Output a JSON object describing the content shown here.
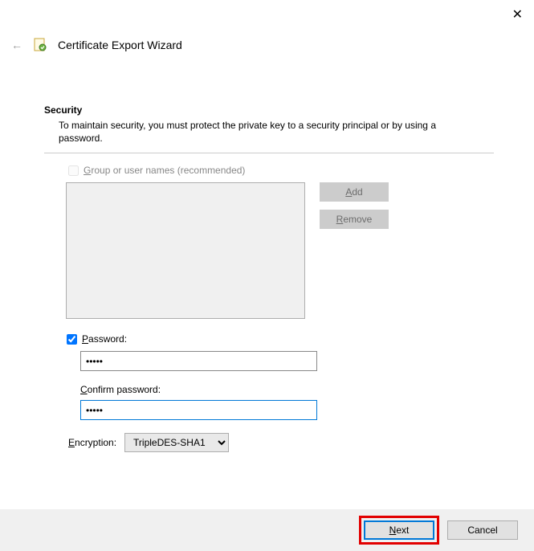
{
  "window": {
    "title": "Certificate Export Wizard"
  },
  "section": {
    "heading": "Security",
    "description": "To maintain security, you must protect the private key to a security principal or by using a password."
  },
  "groups": {
    "checkbox_label_prefix": "G",
    "checkbox_label_rest": "roup or user names (recommended)",
    "checked": false,
    "disabled": true,
    "add_label_prefix": "A",
    "add_label_rest": "dd",
    "remove_label_prefix": "R",
    "remove_label_rest": "emove"
  },
  "password": {
    "checkbox_label_prefix": "P",
    "checkbox_label_rest": "assword:",
    "checked": true,
    "value": "•••••",
    "confirm_label_prefix": "C",
    "confirm_label_rest": "onfirm password:",
    "confirm_value": "•••••"
  },
  "encryption": {
    "label_prefix": "E",
    "label_rest": "ncryption:",
    "selected": "TripleDES-SHA1"
  },
  "footer": {
    "next_prefix": "N",
    "next_rest": "ext",
    "cancel": "Cancel"
  }
}
